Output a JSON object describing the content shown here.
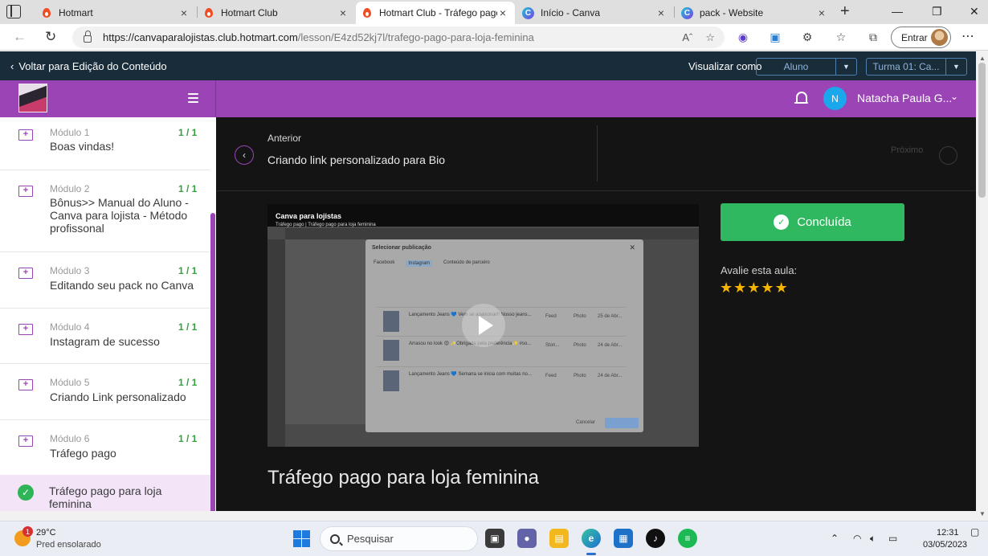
{
  "browser": {
    "tabs": [
      {
        "title": "Hotmart",
        "icon": "hotmart-flame-icon",
        "active": false
      },
      {
        "title": "Hotmart Club",
        "icon": "hotmart-flame-icon",
        "active": false
      },
      {
        "title": "Hotmart Club - Tráfego pago",
        "icon": "hotmart-flame-icon",
        "active": true
      },
      {
        "title": "Início - Canva",
        "icon": "canva-icon",
        "active": false
      },
      {
        "title": "pack - Website",
        "icon": "canva-icon",
        "active": false
      }
    ],
    "close_glyph": "×",
    "new_tab_glyph": "+",
    "url_host": "https://canvaparalojistas.club.hotmart.com",
    "url_path": "/lesson/E4zd52kj7l/trafego-pago-para-loja-feminina",
    "signin_label": "Entrar"
  },
  "editbar": {
    "back_label": "Voltar para Edição do Conteúdo",
    "view_as_label": "Visualizar como",
    "role_value": "Aluno",
    "class_value": "Turma 01: Ca..."
  },
  "header": {
    "user_initial": "N",
    "user_name": "Natacha Paula G..."
  },
  "sidebar": {
    "modules": [
      {
        "number": "Módulo 1",
        "title": "Boas vindas!",
        "progress": "1 / 1"
      },
      {
        "number": "Módulo 2",
        "title": "Bônus>> Manual do Aluno - Canva para lojista - Método profissonal",
        "progress": "1 / 1"
      },
      {
        "number": "Módulo 3",
        "title": "Editando seu pack no Canva",
        "progress": "1 / 1"
      },
      {
        "number": "Módulo 4",
        "title": "Instagram de sucesso",
        "progress": "1 / 1"
      },
      {
        "number": "Módulo 5",
        "title": "Criando Link personalizado",
        "progress": "1 / 1"
      },
      {
        "number": "Módulo 6",
        "title": "Tráfego pago",
        "progress": "1 / 1"
      }
    ],
    "current_lesson": "Tráfego pago para loja feminina"
  },
  "lesson_nav": {
    "prev_label": "Anterior",
    "prev_title": "Criando link personalizado para Bio",
    "next_label": "Próximo"
  },
  "video": {
    "title": "Canva para lojistas",
    "subtitle": "Tráfego pago | Tráfego pago para loja feminina",
    "dialog_title": "Selecionar publicação",
    "dialog_tabs": [
      "Facebook",
      "Instagram",
      "Conteúdo de parceiro"
    ],
    "rows": [
      {
        "text": "Lançamento Jeans 💙 Vem se apaixonar!! Nosso jeans...",
        "source": "Feed",
        "media": "Photo",
        "date": "25 de Abr..."
      },
      {
        "text": "Arrasou no look 😍 ✨Obrigada pela preferência✨ #so...",
        "source": "Stori...",
        "media": "Photo",
        "date": "24 de Abr..."
      },
      {
        "text": "Lançamento Jeans 💙 Semana se inicia com muitas no...",
        "source": "Feed",
        "media": "Photo",
        "date": "24 de Abr..."
      }
    ],
    "cancel_label": "Cancelar"
  },
  "lesson": {
    "done_label": "Concluída",
    "rate_label": "Avalie esta aula:",
    "rating": 5,
    "title": "Tráfego pago para loja feminina"
  },
  "taskbar": {
    "weather_badge": "1",
    "temperature": "29°C",
    "weather": "Pred ensolarado",
    "search_placeholder": "Pesquisar",
    "time": "12:31",
    "date": "03/05/2023"
  },
  "colors": {
    "brand_purple": "#9b44b6",
    "success_green": "#2fb85f",
    "star_yellow": "#f5b400"
  }
}
